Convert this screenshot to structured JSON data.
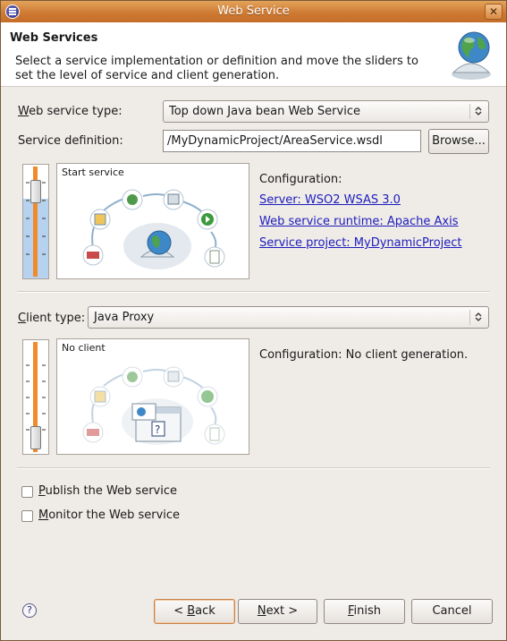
{
  "window": {
    "title": "Web Service",
    "close_label": "✕"
  },
  "header": {
    "title": "Web Services",
    "description": "Select a service implementation or definition and move the sliders to set the level of service and client generation."
  },
  "service_type": {
    "label_u": "W",
    "label_rest": "eb service type:",
    "value": "Top down Java bean Web Service"
  },
  "service_definition": {
    "label": "Service definition:",
    "value": "/MyDynamicProject/AreaService.wsdl",
    "browse_label": "Browse..."
  },
  "service_diagram": {
    "caption": "Start service",
    "level": 1.0
  },
  "service_config": {
    "heading": "Configuration:",
    "server": "Server: WSO2 WSAS 3.0",
    "runtime": "Web service runtime: Apache Axis",
    "project": "Service project: MyDynamicProject"
  },
  "client_type": {
    "label_u": "C",
    "label_rest": "lient type:",
    "value": "Java Proxy"
  },
  "client_diagram": {
    "caption": "No client",
    "level": 0.0
  },
  "client_config": {
    "text": "Configuration: No client generation."
  },
  "options": {
    "publish": {
      "label_u": "P",
      "label_rest": "ublish the Web service",
      "checked": false
    },
    "monitor": {
      "label_u": "M",
      "label_rest": "onitor the Web service",
      "checked": false
    }
  },
  "buttons": {
    "back_pre": "< ",
    "back_u": "B",
    "back_rest": "ack",
    "next_u": "N",
    "next_rest": "ext >",
    "finish_u": "F",
    "finish_rest": "inish",
    "cancel": "Cancel"
  },
  "help": "?",
  "colors": {
    "titlebar": "#d4843c",
    "link": "#1d1dbd",
    "window_bg": "#efebe7",
    "slider_fill": "#b7d2ee"
  }
}
